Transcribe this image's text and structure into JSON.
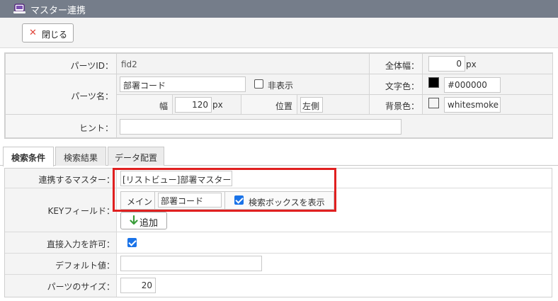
{
  "window": {
    "title": "マスター連携",
    "icon": "window-icon"
  },
  "toolbar": {
    "close_label": "閉じる",
    "close_icon": "close-icon"
  },
  "props": {
    "parts_id_label": "パーツID：",
    "parts_id_value": "fid2",
    "total_width_label": "全体幅：",
    "total_width_value": "0",
    "px": "px",
    "parts_name_label": "パーツ名：",
    "parts_name_value": "部署コード",
    "hide_label": "非表示",
    "text_color_label": "文字色：",
    "text_color_value": "#000000",
    "width_label": "幅",
    "width_value": "120",
    "position_label": "位置",
    "position_value": "左側",
    "bg_color_label": "背景色：",
    "bg_color_value": "whitesmoke",
    "hint_label": "ヒント：",
    "hint_value": ""
  },
  "tabs": [
    "検索条件",
    "検索結果",
    "データ配置"
  ],
  "search": {
    "master_label": "連携するマスター：",
    "master_value": "[リストビュー]部署マスター",
    "key_label": "KEYフィールド：",
    "key_main": "メイン",
    "key_field": "部署コード",
    "show_searchbox_label": "検索ボックスを表示",
    "add_label": "追加",
    "direct_input_label": "直接入力を許可：",
    "default_label": "デフォルト値：",
    "default_value": "",
    "size_label": "パーツのサイズ：",
    "size_value": "20"
  },
  "colors": {
    "titlebar": "#757d8a",
    "accent": "#1a73e8",
    "highlight": "#e02020",
    "close_x": "#e0453a",
    "add_arrow": "#3a9d3a"
  }
}
